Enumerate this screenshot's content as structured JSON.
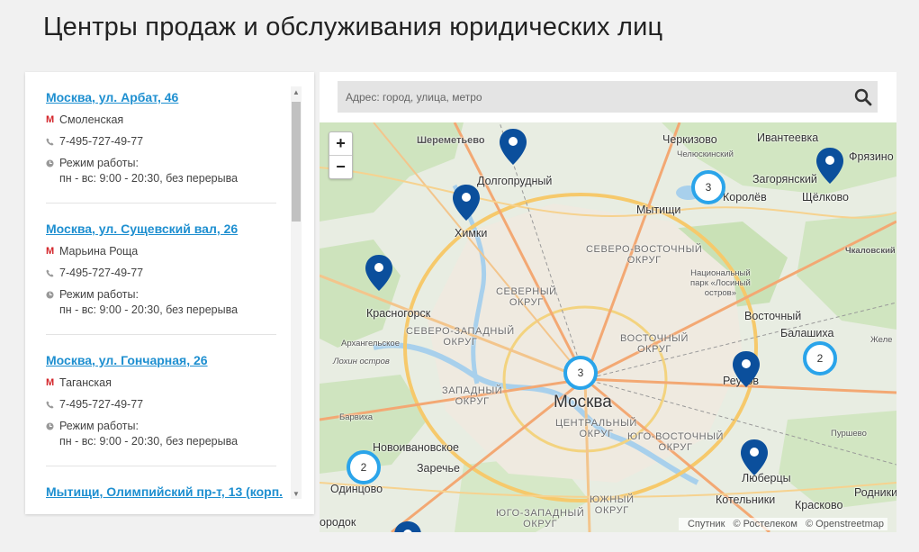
{
  "page": {
    "title": "Центры продаж и обслуживания юридических лиц"
  },
  "offices": [
    {
      "title": "Москва, ул. Арбат, 46",
      "metro": "Смоленская",
      "phone": "7-495-727-49-77",
      "hours_label": "Режим работы:",
      "hours": "пн - вс: 9:00 - 20:30, без перерыва"
    },
    {
      "title": "Москва, ул. Сущевский вал, 26",
      "metro": "Марьина Роща",
      "phone": "7-495-727-49-77",
      "hours_label": "Режим работы:",
      "hours": "пн - вс: 9:00 - 20:30, без перерыва"
    },
    {
      "title": "Москва, ул. Гончарная, 26",
      "metro": "Таганская",
      "phone": "7-495-727-49-77",
      "hours_label": "Режим работы:",
      "hours": "пн - вс: 9:00 - 20:30, без перерыва"
    },
    {
      "title": "Мытищи, Олимпийский пр-т, 13 (корп."
    }
  ],
  "icons": {
    "metro": "metro-icon",
    "phone": "phone-icon",
    "clock": "clock-icon",
    "search": "search-icon",
    "pin": "map-pin-icon"
  },
  "search": {
    "placeholder": "Адрес: город, улица, метро"
  },
  "zoom": {
    "in": "+",
    "out": "−"
  },
  "map_labels": {
    "sheremetyevo": "Шереметьево",
    "dolgoprudny": "Долгопрудный",
    "cherkizovo": "Черкизово",
    "chelyuskinsky": "Челюскинский",
    "ivanteevka": "Ивантеевка",
    "fryazino": "Фрязино",
    "zagoryansky": "Загорянский",
    "korolev": "Королёв",
    "shchelkovo": "Щёлково",
    "mytishchi": "Мытищи",
    "khimki": "Химки",
    "chkalovsky": "Чкаловский",
    "svao": "СЕВЕРО-ВОСТОЧНЫЙ\nОКРУГ",
    "losiny": "Национальный\nпарк «Лосиный\nостров»",
    "sao": "СЕВЕРНЫЙ\nОКРУГ",
    "krasnogorsk": "Красногорск",
    "szao": "СЕВЕРО-ЗАПАДНЫЙ\nОКРУГ",
    "vostochny": "Восточный",
    "arkhangelskoe": "Архангельское",
    "vao": "ВОСТОЧНЫЙ\nОКРУГ",
    "balashikha": "Балашиха",
    "lokhin": "Лохин остров",
    "zao": "ЗАПАДНЫЙ\nОКРУГ",
    "moskva": "Москва",
    "reutov": "Реутов",
    "barvikha": "Барвиха",
    "tsao": "ЦЕНТРАЛЬНЫЙ\nОКРУГ",
    "yuvao": "ЮГО-ВОСТОЧНЫЙ\nОКРУГ",
    "novoivanovskoe": "Новоивановское",
    "zarechye": "Заречье",
    "lyubertsy": "Люберцы",
    "odintsovo": "Одинцово",
    "yuao": "ЮЖНЫЙ\nОКРУГ",
    "kotelniki": "Котельники",
    "krasnovo": "Красково",
    "rodniki": "Родники",
    "purshevo": "Пуршево",
    "yuzao": "ЮГО-ЗАПАДНЫЙ\nОКРУГ",
    "gorodok": "ородок",
    "zheleznodorozhny": "Желе"
  },
  "clusters": [
    {
      "id": "korolev",
      "count": "3"
    },
    {
      "id": "center",
      "count": "3"
    },
    {
      "id": "balashikha",
      "count": "2"
    },
    {
      "id": "odintsovo",
      "count": "2"
    }
  ],
  "attribution": {
    "sputnik": "Спутник",
    "rostelecom": "© Ростелеком",
    "osm": "© Openstreetmap"
  },
  "colors": {
    "link": "#1e8fd0",
    "cluster": "#2aa4ea",
    "pin": "#0b4f9c",
    "metro": "#d4262b"
  }
}
